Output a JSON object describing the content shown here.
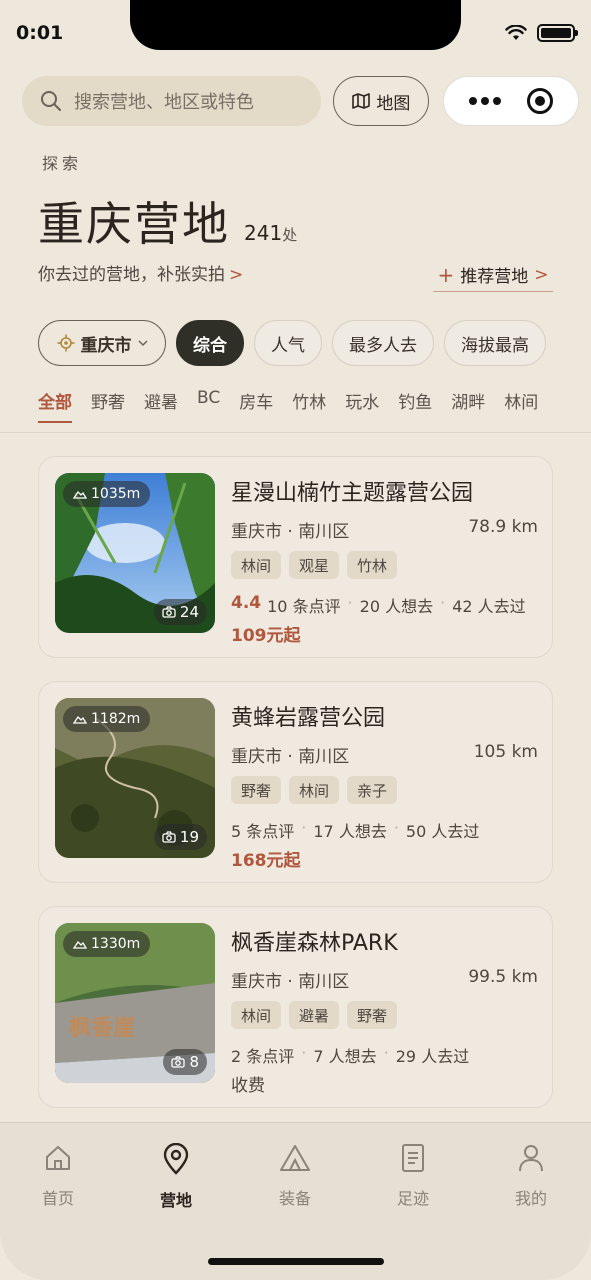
{
  "status_bar": {
    "time": "0:01"
  },
  "search": {
    "placeholder": "搜索营地、地区或特色",
    "map_label": "地图"
  },
  "header": {
    "explore_label": "探索",
    "title": "重庆营地",
    "count": "241",
    "count_unit": "处",
    "revisit_text": "你去过的营地，补张实拍",
    "revisit_arrow": ">",
    "recommend_label": "推荐营地",
    "recommend_plus": "+",
    "recommend_arrow": ">"
  },
  "sort": {
    "city": "重庆市",
    "options": [
      "综合",
      "人气",
      "最多人去",
      "海拔最高"
    ],
    "active": "综合"
  },
  "categories": [
    "全部",
    "野奢",
    "避暑",
    "BC",
    "房车",
    "竹林",
    "玩水",
    "钓鱼",
    "湖畔",
    "林间"
  ],
  "cards": [
    {
      "name": "星漫山楠竹主题露营公园",
      "location": "重庆市 · 南川区",
      "distance": "78.9 km",
      "elevation": "1035m",
      "photos": "24",
      "tags": [
        "林间",
        "观星",
        "竹林"
      ],
      "rating": "4.4",
      "reviews": "10 条点评",
      "want": "20 人想去",
      "been": "42 人去过",
      "price": "109元起"
    },
    {
      "name": "黄蜂岩露营公园",
      "location": "重庆市 · 南川区",
      "distance": "105 km",
      "elevation": "1182m",
      "photos": "19",
      "tags": [
        "野奢",
        "林间",
        "亲子"
      ],
      "rating": "",
      "reviews": "5 条点评",
      "want": "17 人想去",
      "been": "50 人去过",
      "price": "168元起"
    },
    {
      "name": "枫香崖森林PARK",
      "location": "重庆市 · 南川区",
      "distance": "99.5 km",
      "elevation": "1330m",
      "photos": "8",
      "tags": [
        "林间",
        "避暑",
        "野奢"
      ],
      "rating": "",
      "reviews": "2 条点评",
      "want": "7 人想去",
      "been": "29 人去过",
      "price": "收费"
    }
  ],
  "tabbar": [
    {
      "label": "首页",
      "icon": "home-icon"
    },
    {
      "label": "营地",
      "icon": "location-pin-icon"
    },
    {
      "label": "装备",
      "icon": "tent-icon"
    },
    {
      "label": "足迹",
      "icon": "notebook-icon"
    },
    {
      "label": "我的",
      "icon": "person-icon"
    }
  ],
  "colors": {
    "accent": "#b0573d",
    "background": "#ede7dc",
    "active_pill": "#2f2f28"
  }
}
